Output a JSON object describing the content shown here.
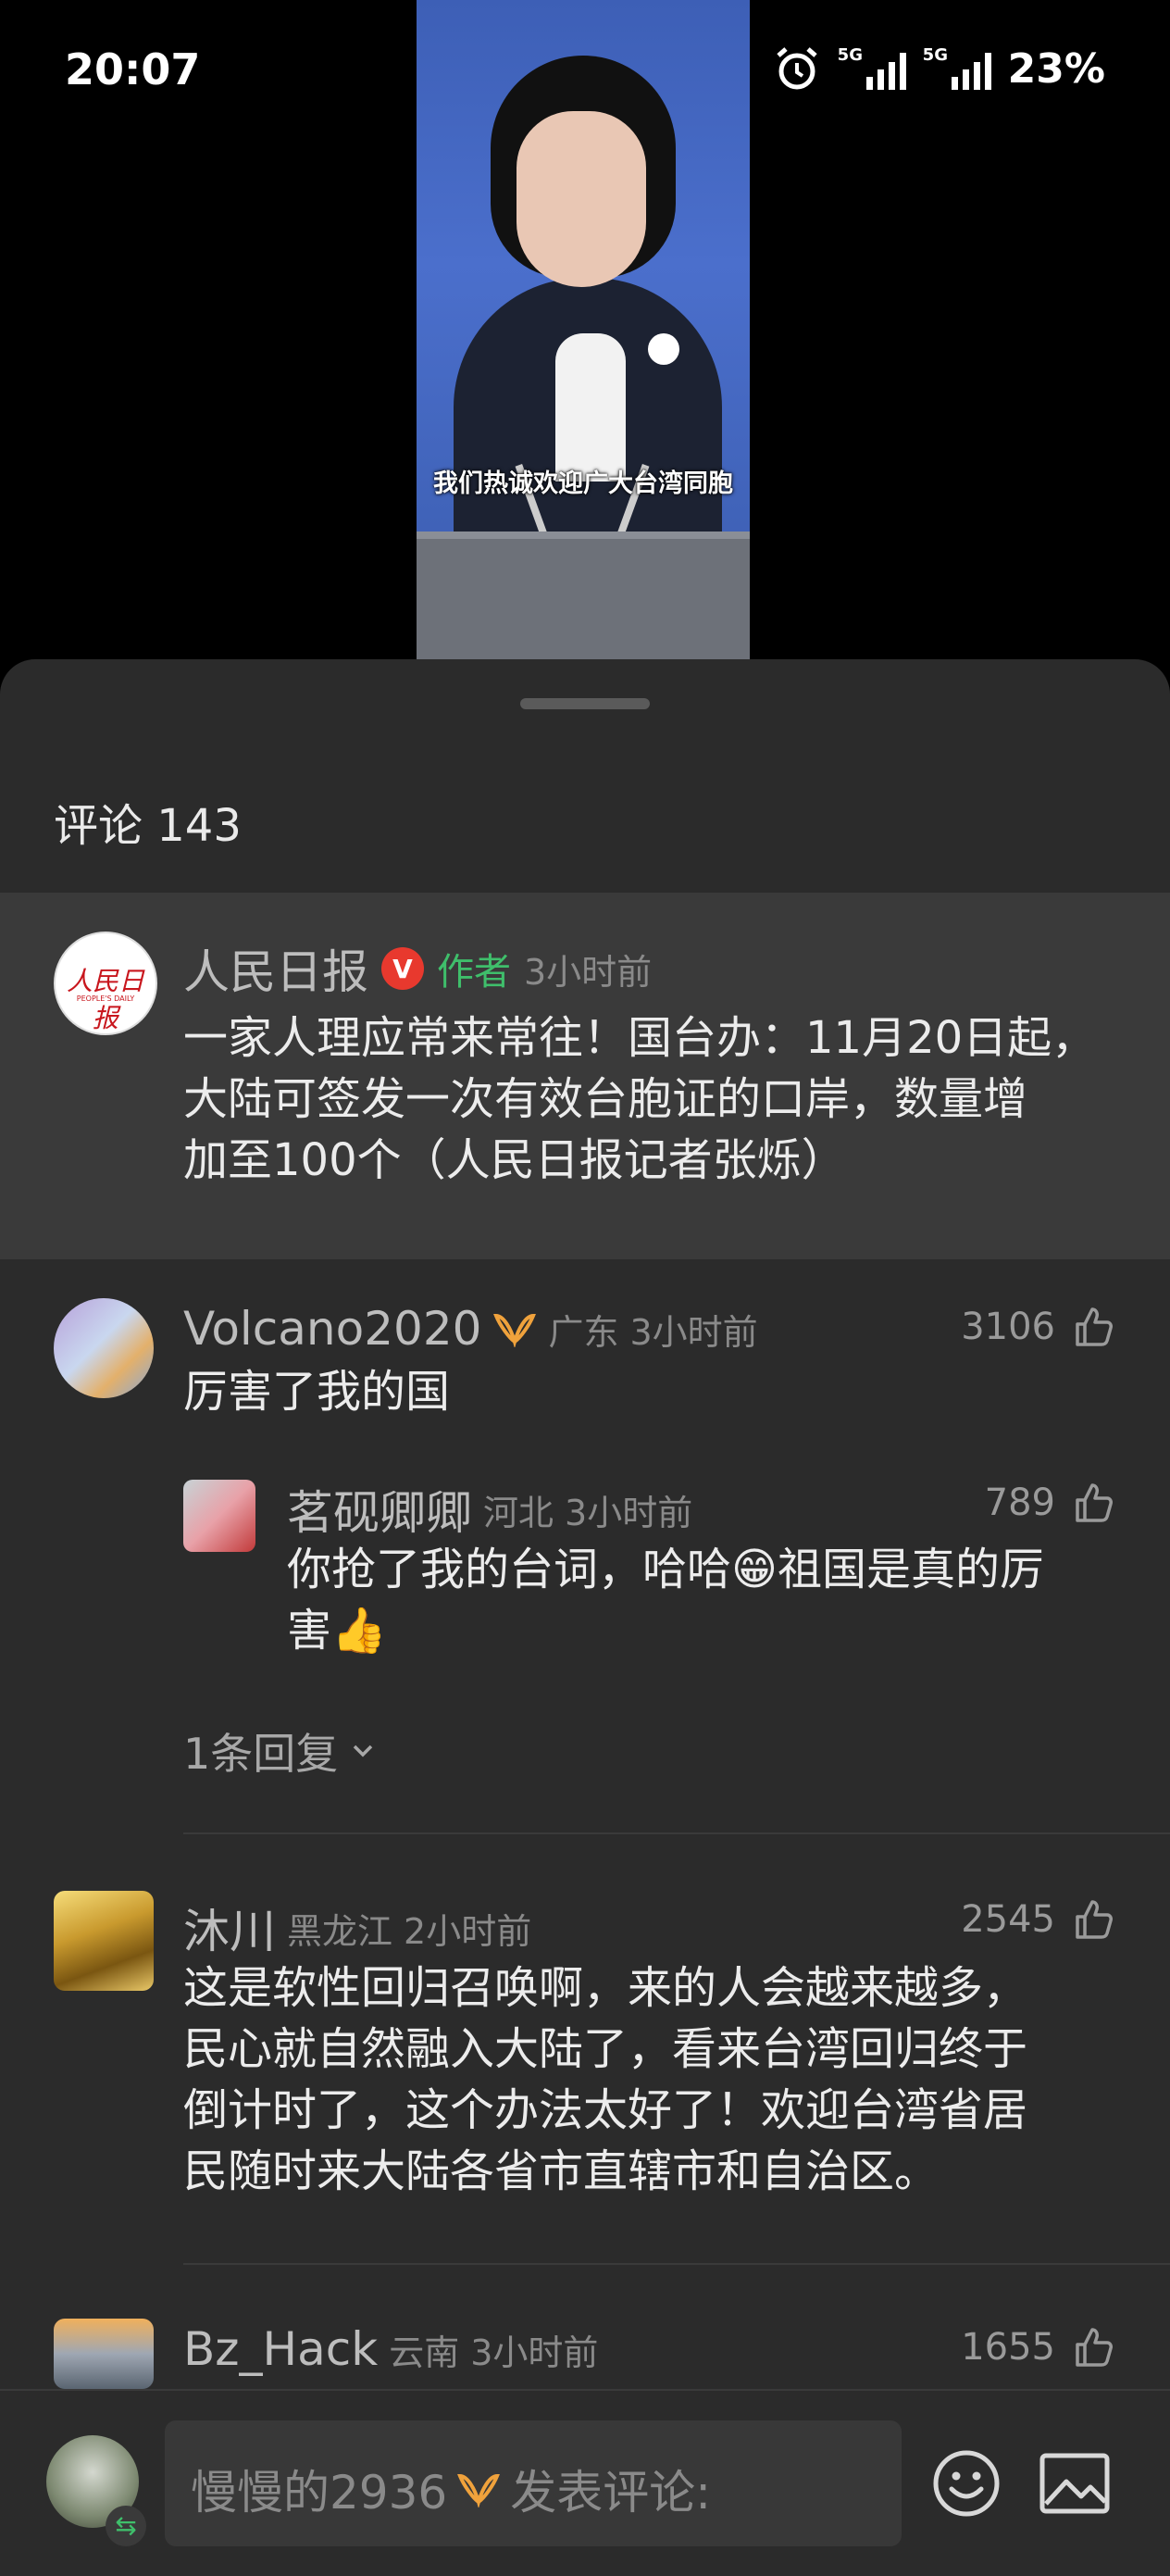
{
  "status": {
    "time": "20:07",
    "net1": "5G",
    "net2": "5G",
    "battery": "23%"
  },
  "video": {
    "subtitle": "我们热诚欢迎广大台湾同胞"
  },
  "sheet": {
    "header": "评论 143"
  },
  "comments": [
    {
      "name": "人民日报",
      "badge": "V",
      "role": "作者",
      "time": "3小时前",
      "text_lines": [
        "一家人理应常来常往！国台办：11月20日起，",
        "大陆可签发一次有效台胞证的口岸，数量增",
        "加至100个（人民日报记者张烁）"
      ],
      "avatar_text": "人民日报",
      "avatar_sub": "PEOPLE'S DAILY"
    },
    {
      "name": "Volcano2020",
      "region": "广东",
      "time": "3小时前",
      "likes": "3106",
      "text_lines": [
        "厉害了我的国"
      ]
    },
    {
      "name": "茗砚卿卿",
      "region": "河北",
      "time": "3小时前",
      "likes": "789",
      "text_lines": [
        "你抢了我的台词，哈哈😁祖国是真的厉",
        "害👍"
      ]
    },
    {
      "name": "沐川",
      "region": "黑龙江",
      "time": "2小时前",
      "likes": "2545",
      "text_lines": [
        "这是软性回归召唤啊，来的人会越来越多，",
        "民心就自然融入大陆了，看来台湾回归终于",
        "倒计时了，这个办法太好了！欢迎台湾省居",
        "民随时来大陆各省市直辖市和自治区。"
      ]
    },
    {
      "name": "Bz_Hack",
      "region": "云南",
      "time": "3小时前",
      "likes": "1655",
      "text_lines": []
    }
  ],
  "replies_toggle": "1条回复",
  "footer": {
    "placeholder_user": "慢慢的2936",
    "placeholder_action": "发表评论:"
  },
  "colors": {
    "accent_green": "#3fbf6b",
    "badge_red": "#e8392e",
    "vip_orange": "#f0a23c"
  }
}
